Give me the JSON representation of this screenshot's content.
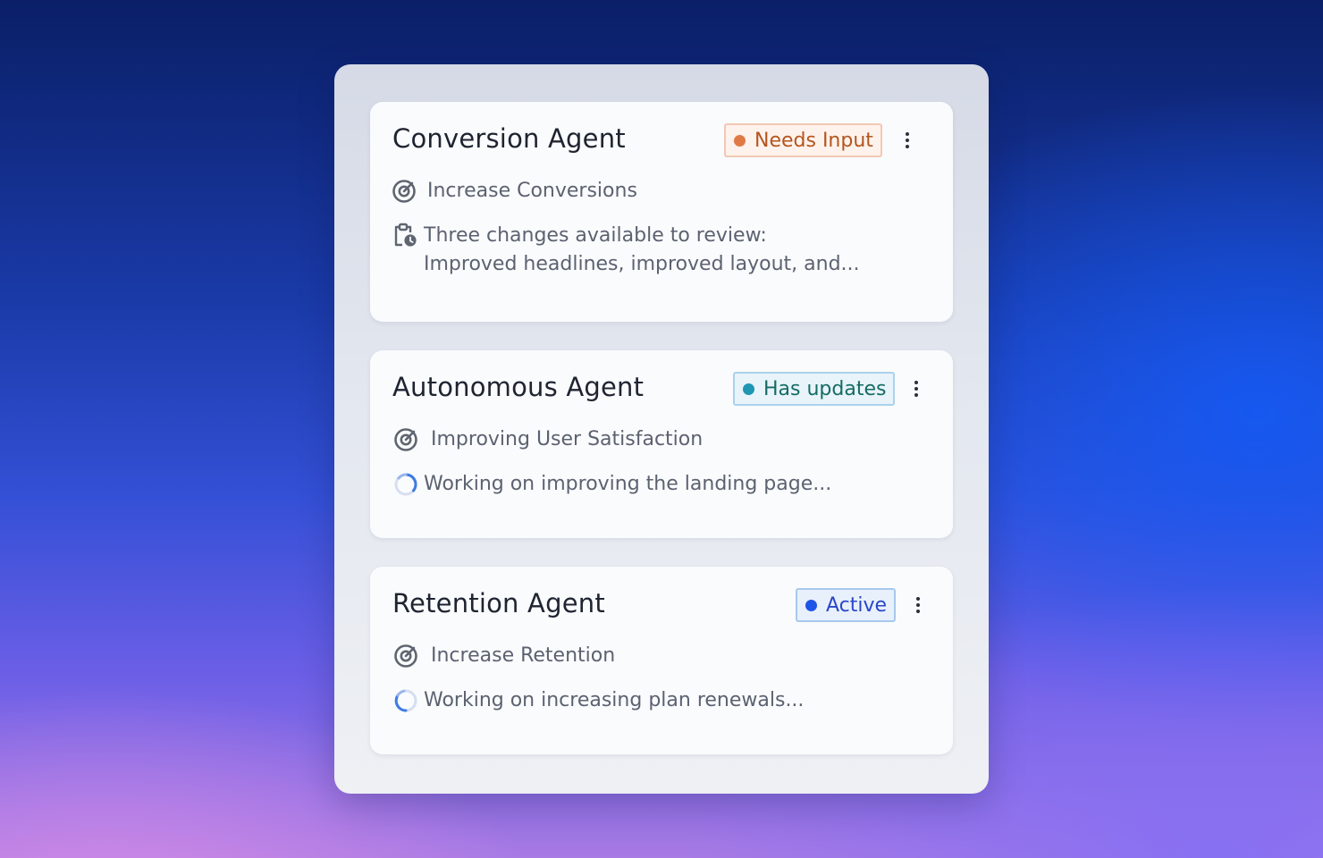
{
  "agents": [
    {
      "name": "Conversion Agent",
      "status": {
        "label": "Needs Input",
        "text_color": "#b4561e",
        "border_color": "#f2c8b4",
        "bg_color": "#fdf2ec",
        "dot_color": "#e07a45"
      },
      "goal": {
        "icon": "target-icon",
        "text": "Increase Conversions"
      },
      "activity": {
        "icon": "clipboard-clock-icon",
        "lines": [
          "Three changes available to review:",
          "Improved headlines, improved layout, and..."
        ]
      }
    },
    {
      "name": "Autonomous Agent",
      "status": {
        "label": "Has updates",
        "text_color": "#146c63",
        "border_color": "#a9d2ec",
        "bg_color": "#e9f3fa",
        "dot_color": "#1e96b4"
      },
      "goal": {
        "icon": "target-icon",
        "text": "Improving User Satisfaction"
      },
      "activity": {
        "icon": "loading-spinner-icon",
        "lines": [
          "Working on improving the landing page..."
        ]
      }
    },
    {
      "name": "Retention Agent",
      "status": {
        "label": "Active",
        "text_color": "#2a46c8",
        "border_color": "#a7c8ee",
        "bg_color": "#e8f0fb",
        "dot_color": "#1f55e6"
      },
      "goal": {
        "icon": "target-icon",
        "text": "Increase Retention"
      },
      "activity": {
        "icon": "loading-spinner-icon",
        "lines": [
          "Working on increasing plan renewals..."
        ]
      }
    }
  ],
  "colors": {
    "title": "#1e2430",
    "body_text": "#5b6270",
    "icon": "#5f6570",
    "spinner_accent": "#3f7be0"
  }
}
